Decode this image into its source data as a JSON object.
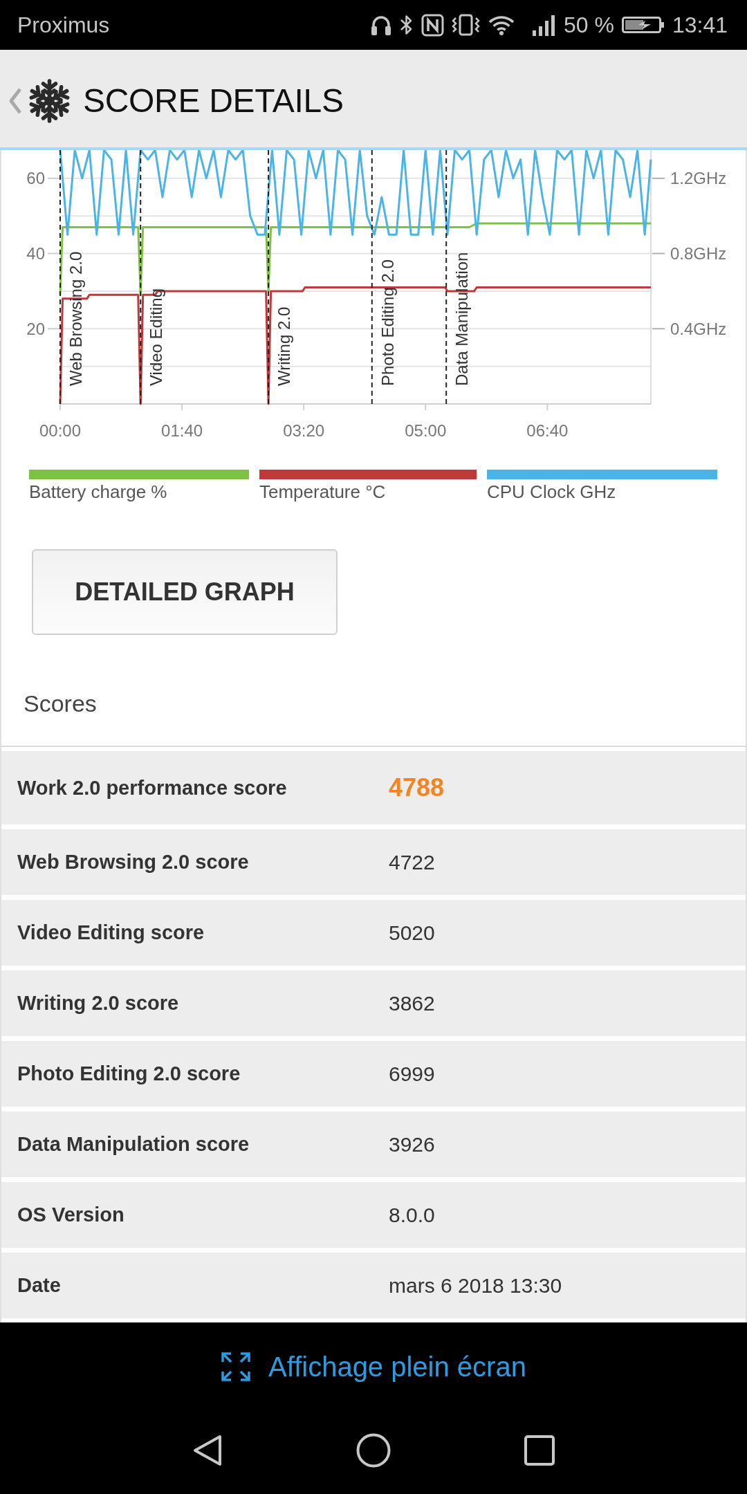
{
  "status_bar": {
    "carrier": "Proximus",
    "battery": "50 %",
    "time": "13:41"
  },
  "header": {
    "title": "SCORE DETAILS"
  },
  "chart": {
    "chart_data": {
      "type": "line",
      "xlim": [
        0,
        485
      ],
      "ylim": [
        0,
        67.5
      ],
      "y2lim": [
        0,
        1.35
      ],
      "grid": true,
      "xticks": [
        {
          "value": 0,
          "label": "00:00"
        },
        {
          "value": 100,
          "label": "01:40"
        },
        {
          "value": 200,
          "label": "03:20"
        },
        {
          "value": 300,
          "label": "05:00"
        },
        {
          "value": 400,
          "label": "06:40"
        }
      ],
      "yticks": [
        20,
        40,
        60
      ],
      "y2ticks": [
        {
          "value": 0.4,
          "label": "0.4GHz"
        },
        {
          "value": 0.8,
          "label": "0.8GHz"
        },
        {
          "value": 1.2,
          "label": "1.2GHz"
        }
      ],
      "series": [
        {
          "name": "Battery charge %",
          "color": "#7dc242",
          "x": [
            0,
            2,
            64,
            66,
            68,
            169,
            171,
            173,
            336,
            342,
            485
          ],
          "values": [
            29,
            47,
            47,
            29,
            47,
            47,
            30,
            47,
            47,
            48,
            48
          ]
        },
        {
          "name": "Temperature °C",
          "color": "#c0393a",
          "x": [
            0,
            2,
            22,
            24,
            64,
            66,
            68,
            78,
            80,
            169,
            171,
            173,
            199,
            201,
            316,
            318,
            340,
            342,
            485
          ],
          "values": [
            0,
            28,
            28,
            29,
            29,
            0,
            29,
            29,
            30,
            30,
            0,
            30,
            30,
            31,
            31,
            30,
            30,
            31,
            31
          ]
        },
        {
          "name": "CPU Clock GHz",
          "color": "#4bb4e6",
          "axis": "y2",
          "x": [
            0,
            6,
            12,
            18,
            24,
            30,
            36,
            42,
            48,
            54,
            60,
            66,
            72,
            78,
            84,
            90,
            96,
            102,
            108,
            114,
            120,
            126,
            132,
            138,
            144,
            150,
            156,
            162,
            168,
            174,
            180,
            186,
            192,
            198,
            204,
            210,
            216,
            222,
            228,
            234,
            240,
            246,
            252,
            258,
            264,
            270,
            276,
            282,
            288,
            294,
            300,
            306,
            312,
            318,
            324,
            330,
            336,
            342,
            348,
            354,
            360,
            366,
            372,
            378,
            384,
            390,
            396,
            402,
            408,
            414,
            420,
            426,
            432,
            438,
            444,
            450,
            456,
            462,
            468,
            474,
            480,
            485
          ],
          "values": [
            1.35,
            0.9,
            1.35,
            1.2,
            1.35,
            0.9,
            1.35,
            1.3,
            0.9,
            1.35,
            0.9,
            1.35,
            1.3,
            1.35,
            1.1,
            1.35,
            1.3,
            1.35,
            1.1,
            1.35,
            1.2,
            1.35,
            1.1,
            1.35,
            1.3,
            1.35,
            1.0,
            0.9,
            0.9,
            1.35,
            0.9,
            1.35,
            1.3,
            0.9,
            1.35,
            1.2,
            1.35,
            0.9,
            1.35,
            1.3,
            0.9,
            1.35,
            1.0,
            0.9,
            1.1,
            0.9,
            0.9,
            1.35,
            0.9,
            0.9,
            1.35,
            0.9,
            1.35,
            0.9,
            1.35,
            1.3,
            1.35,
            0.9,
            1.3,
            1.35,
            1.1,
            1.35,
            1.2,
            1.3,
            0.9,
            1.35,
            1.1,
            0.9,
            1.35,
            1.3,
            1.35,
            0.9,
            1.35,
            1.2,
            1.35,
            0.9,
            1.35,
            1.3,
            1.1,
            1.35,
            0.9,
            1.3
          ]
        }
      ],
      "ref_lines": [
        {
          "axis": "x",
          "value": 0,
          "label": "Web Browsing 2.0"
        },
        {
          "axis": "x",
          "value": 66,
          "label": "Video Editing"
        },
        {
          "axis": "x",
          "value": 171,
          "label": "Writing 2.0"
        },
        {
          "axis": "x",
          "value": 256,
          "label": "Photo Editing 2.0"
        },
        {
          "axis": "x",
          "value": 317,
          "label": "Data Manipulation"
        }
      ]
    }
  },
  "detailed_graph_button": {
    "label": "DETAILED GRAPH"
  },
  "scores": {
    "title": "Scores",
    "rows": [
      {
        "label": "Work 2.0 performance score",
        "value": "4788",
        "highlight": true
      },
      {
        "label": "Web Browsing 2.0 score",
        "value": "4722",
        "highlight": false
      },
      {
        "label": "Video Editing score",
        "value": "5020",
        "highlight": false
      },
      {
        "label": "Writing 2.0 score",
        "value": "3862",
        "highlight": false
      },
      {
        "label": "Photo Editing 2.0 score",
        "value": "6999",
        "highlight": false
      },
      {
        "label": "Data Manipulation score",
        "value": "3926",
        "highlight": false
      },
      {
        "label": "OS Version",
        "value": "8.0.0",
        "highlight": false
      },
      {
        "label": "Date",
        "value": "mars 6 2018 13:30",
        "highlight": false
      }
    ]
  },
  "footer": {
    "fullscreen_link": "Affichage plein écran"
  }
}
